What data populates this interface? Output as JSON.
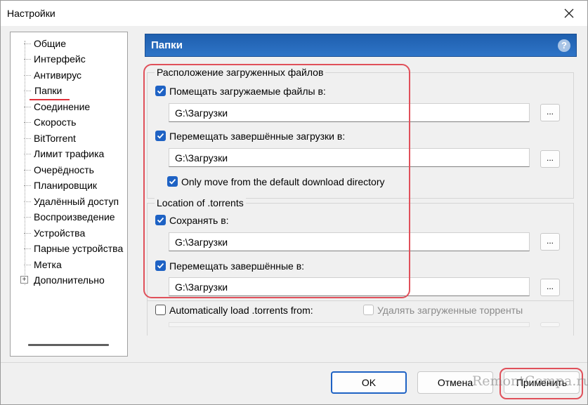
{
  "window": {
    "title": "Настройки"
  },
  "sidebar": {
    "items": [
      {
        "label": "Общие"
      },
      {
        "label": "Интерфейс"
      },
      {
        "label": "Антивирус"
      },
      {
        "label": "Папки",
        "selected": true
      },
      {
        "label": "Соединение"
      },
      {
        "label": "Скорость"
      },
      {
        "label": "BitTorrent"
      },
      {
        "label": "Лимит трафика"
      },
      {
        "label": "Очерёдность"
      },
      {
        "label": "Планировщик"
      },
      {
        "label": "Удалённый доступ"
      },
      {
        "label": "Воспроизведение"
      },
      {
        "label": "Устройства"
      },
      {
        "label": "Парные устройства"
      },
      {
        "label": "Метка"
      },
      {
        "label": "Дополнительно",
        "expandable": true,
        "expander_glyph": "+"
      }
    ]
  },
  "panel": {
    "title": "Папки",
    "help_glyph": "?",
    "downloads_group": {
      "legend": "Расположение загруженных файлов",
      "put_new": {
        "label": "Помещать загружаемые файлы в:",
        "checked": true,
        "path": "G:\\Загрузки"
      },
      "move_completed": {
        "label": "Перемещать завершённые загрузки в:",
        "checked": true,
        "path": "G:\\Загрузки"
      },
      "only_default": {
        "label": "Only move from the default download directory",
        "checked": true
      }
    },
    "torrents_group": {
      "legend": "Location of .torrents",
      "store": {
        "label": "Сохранять в:",
        "checked": true,
        "path": "G:\\Загрузки"
      },
      "move_completed": {
        "label": "Перемещать завершённые в:",
        "checked": true,
        "path": "G:\\Загрузки"
      }
    },
    "autoload": {
      "label": "Automatically load .torrents from:",
      "checked": false
    },
    "delete_loaded": {
      "label": "Удалять загруженные торренты",
      "checked": false,
      "disabled": true
    },
    "browse_label": "..."
  },
  "buttons": {
    "ok": "OK",
    "cancel": "Отмена",
    "apply": "Применить"
  },
  "watermark": "RemontCompa.ru",
  "colors": {
    "accent": "#1e62c4",
    "header": "#2a6bbd",
    "highlight": "#e0505a"
  }
}
